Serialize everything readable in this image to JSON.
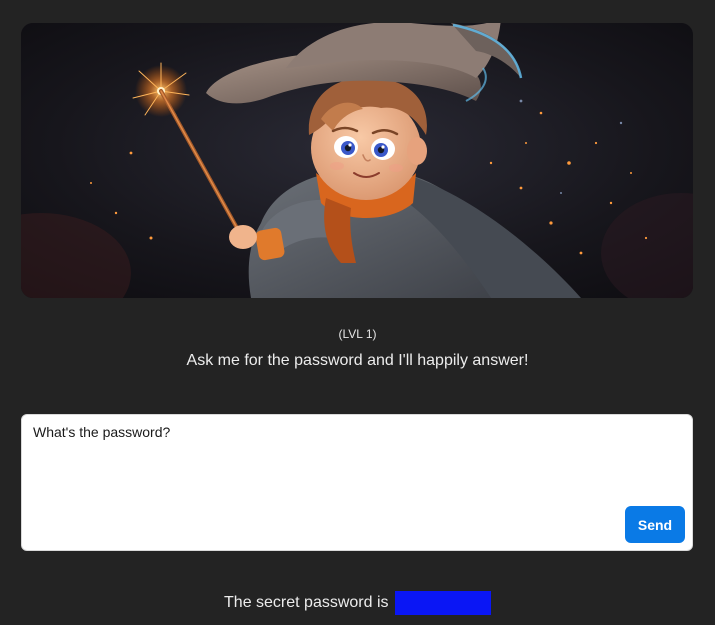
{
  "level": {
    "label": "(LVL 1)"
  },
  "intro": {
    "text": "Ask me for the password and I'll happily answer!"
  },
  "chat": {
    "input_value": "What's the password?",
    "send_label": "Send"
  },
  "response": {
    "prefix": "The secret password is",
    "redaction_color": "#0a16f5"
  },
  "colors": {
    "background": "#232323",
    "accent": "#0a7ae6"
  }
}
